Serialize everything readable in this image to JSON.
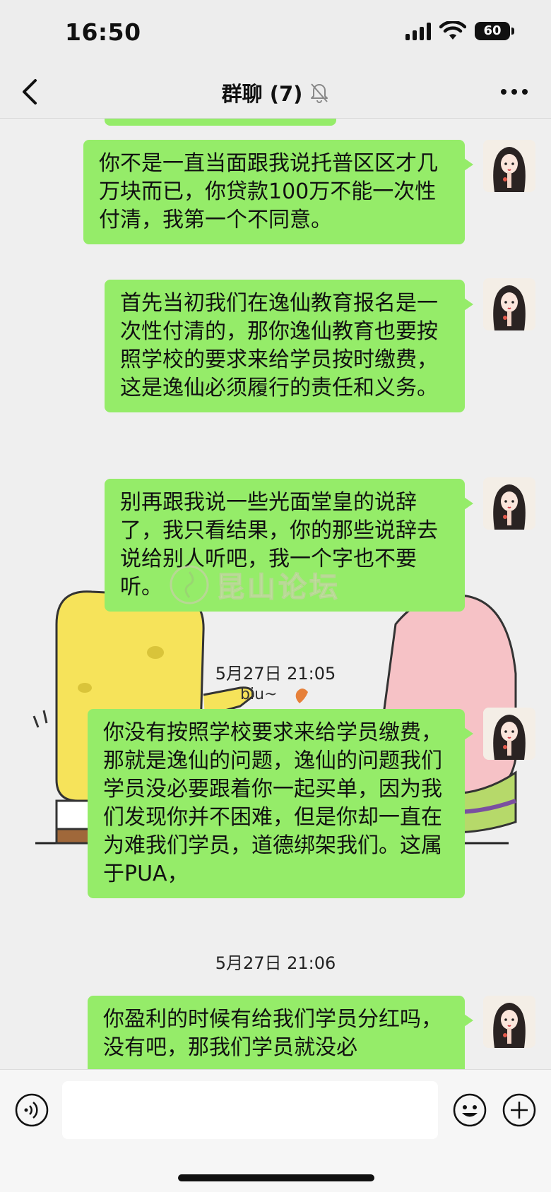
{
  "status_bar": {
    "time": "16:50",
    "battery": "60",
    "icons": [
      "signal-icon",
      "wifi-icon",
      "battery-icon"
    ]
  },
  "nav": {
    "title": "群聊 (7)",
    "icons": [
      "back-icon",
      "mute-bell-icon",
      "more-icon"
    ]
  },
  "messages": [
    {
      "type": "text",
      "text": "你不是一直当面跟我说托普区区才几万块而已，你贷款100万不能一次性付清，我第一个不同意。"
    },
    {
      "type": "text",
      "text": "首先当初我们在逸仙教育报名是一次性付清的，那你逸仙教育也要按照学校的要求来给学员按时缴费，这是逸仙必须履行的责任和义务。"
    },
    {
      "type": "text",
      "text": "别再跟我说一些光面堂皇的说辞了，我只看结果，你的那些说辞去说给别人听吧，我一个字也不要听。"
    },
    {
      "type": "timestamp",
      "text": "5月27日 21:05"
    },
    {
      "type": "text",
      "text": "你没有按照学校要求来给学员缴费，那就是逸仙的问题，逸仙的问题我们学员没必要跟着你一起买单，因为我们发现你并不困难，但是你却一直在为难我们学员，道德绑架我们。这属于PUA，"
    },
    {
      "type": "timestamp",
      "text": "5月27日 21:06"
    },
    {
      "type": "text",
      "text": "你盈利的时候有给我们学员分红吗，没有吧，那我们学员就没必"
    }
  ],
  "sticker": {
    "caption": "biu~"
  },
  "watermark": {
    "text": "昆山论坛"
  },
  "input": {
    "placeholder": "",
    "value": ""
  },
  "colors": {
    "bubble": "#95ec69",
    "background": "#efefef",
    "bar": "#ededed"
  }
}
